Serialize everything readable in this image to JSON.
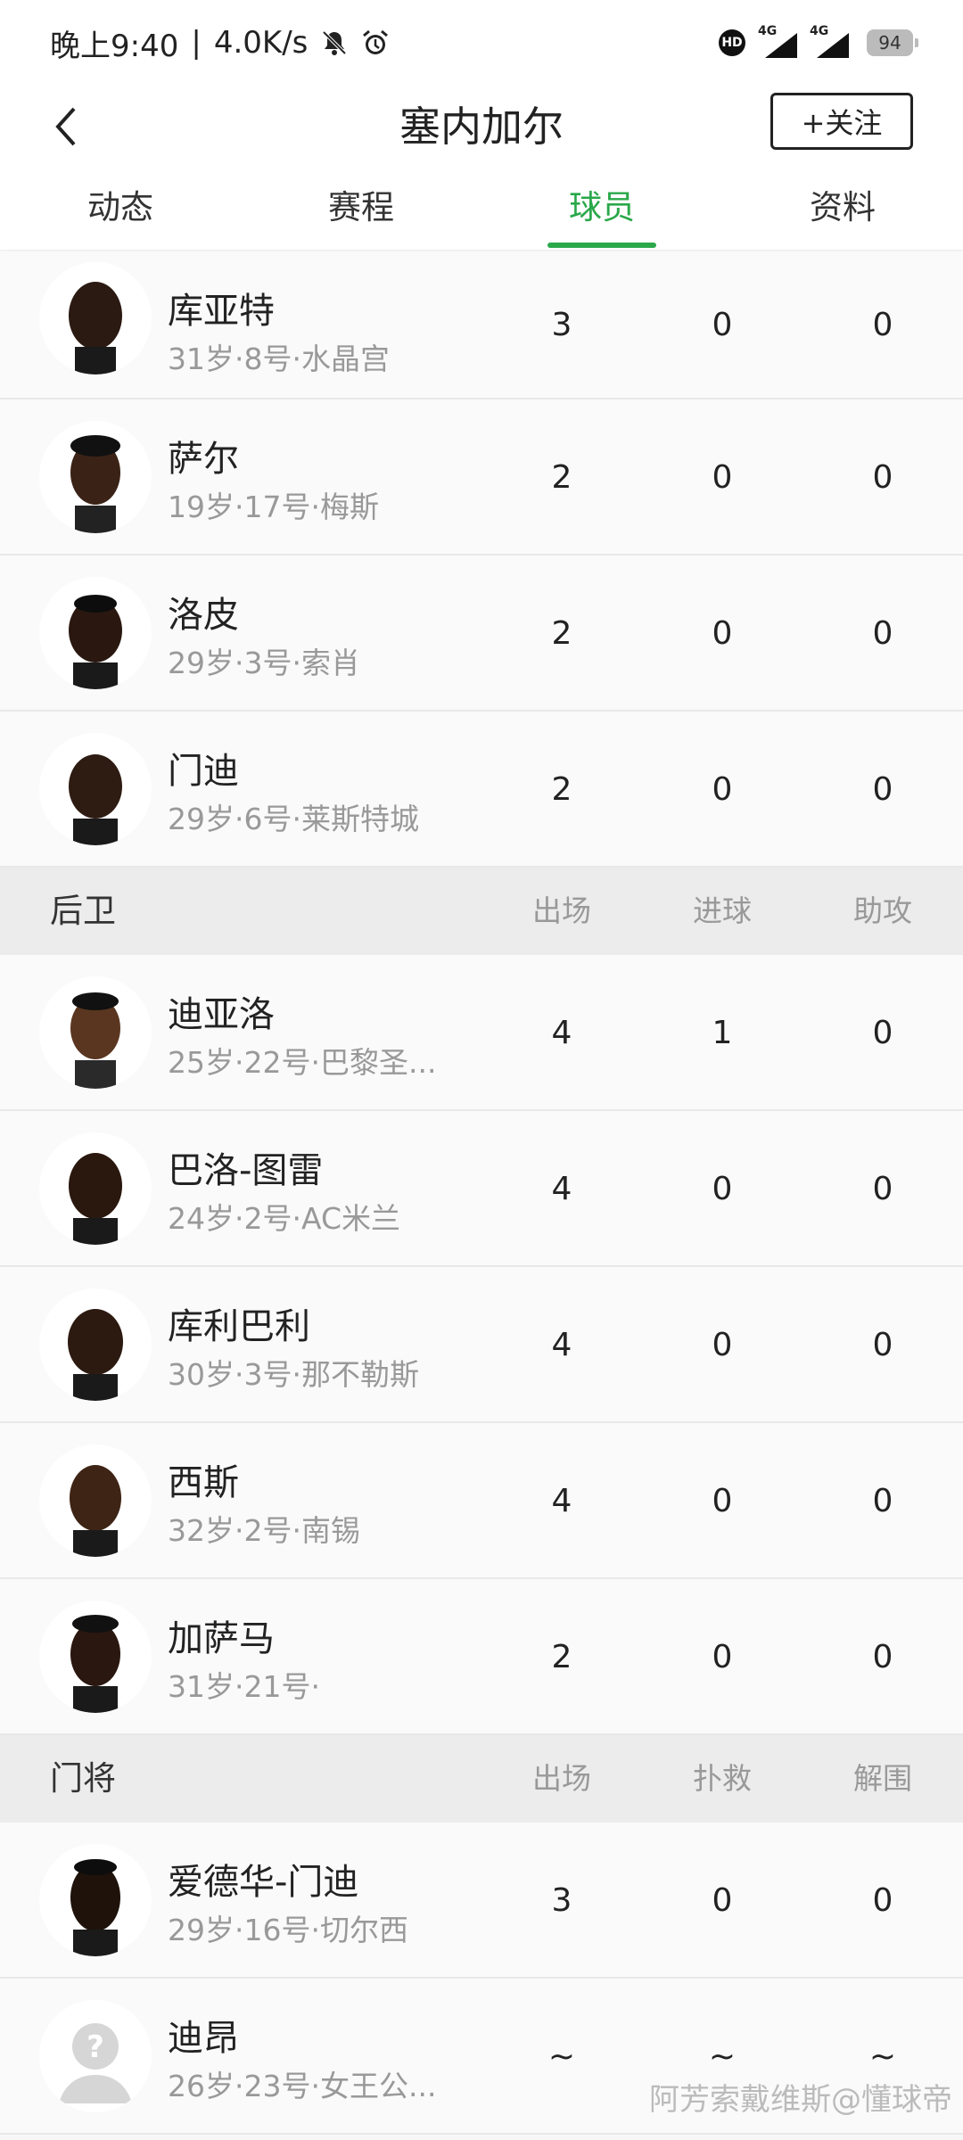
{
  "status_bar": {
    "time": "晚上9:40",
    "speed": "4.0K/s",
    "hd": "HD",
    "network1": "4G",
    "network2": "4G",
    "battery": "94"
  },
  "header": {
    "title": "塞内加尔",
    "follow_label": "+关注"
  },
  "tabs": [
    {
      "label": "动态"
    },
    {
      "label": "赛程"
    },
    {
      "label": "球员"
    },
    {
      "label": "资料"
    }
  ],
  "accent_color": "#2aa84a",
  "top_rows": [
    {
      "name": "库亚特",
      "info": "31岁·8号·水晶宫",
      "s1": "3",
      "s2": "0",
      "s3": "0"
    },
    {
      "name": "萨尔",
      "info": "19岁·17号·梅斯",
      "s1": "2",
      "s2": "0",
      "s3": "0"
    },
    {
      "name": "洛皮",
      "info": "29岁·3号·索肖",
      "s1": "2",
      "s2": "0",
      "s3": "0"
    },
    {
      "name": "门迪",
      "info": "29岁·6号·莱斯特城",
      "s1": "2",
      "s2": "0",
      "s3": "0"
    }
  ],
  "defenders": {
    "title": "后卫",
    "col1": "出场",
    "col2": "进球",
    "col3": "助攻",
    "rows": [
      {
        "name": "迪亚洛",
        "info": "25岁·22号·巴黎圣...",
        "s1": "4",
        "s2": "1",
        "s3": "0"
      },
      {
        "name": "巴洛-图雷",
        "info": "24岁·2号·AC米兰",
        "s1": "4",
        "s2": "0",
        "s3": "0"
      },
      {
        "name": "库利巴利",
        "info": "30岁·3号·那不勒斯",
        "s1": "4",
        "s2": "0",
        "s3": "0"
      },
      {
        "name": "西斯",
        "info": "32岁·2号·南锡",
        "s1": "4",
        "s2": "0",
        "s3": "0"
      },
      {
        "name": "加萨马",
        "info": "31岁·21号·",
        "s1": "2",
        "s2": "0",
        "s3": "0"
      }
    ]
  },
  "goalkeepers": {
    "title": "门将",
    "col1": "出场",
    "col2": "扑救",
    "col3": "解围",
    "rows": [
      {
        "name": "爱德华-门迪",
        "info": "29岁·16号·切尔西",
        "s1": "3",
        "s2": "0",
        "s3": "0"
      },
      {
        "name": "迪昂",
        "info": "26岁·23号·女王公...",
        "s1": "~",
        "s2": "~",
        "s3": "~"
      }
    ]
  },
  "watermark": "阿芳索戴维斯@懂球帝"
}
